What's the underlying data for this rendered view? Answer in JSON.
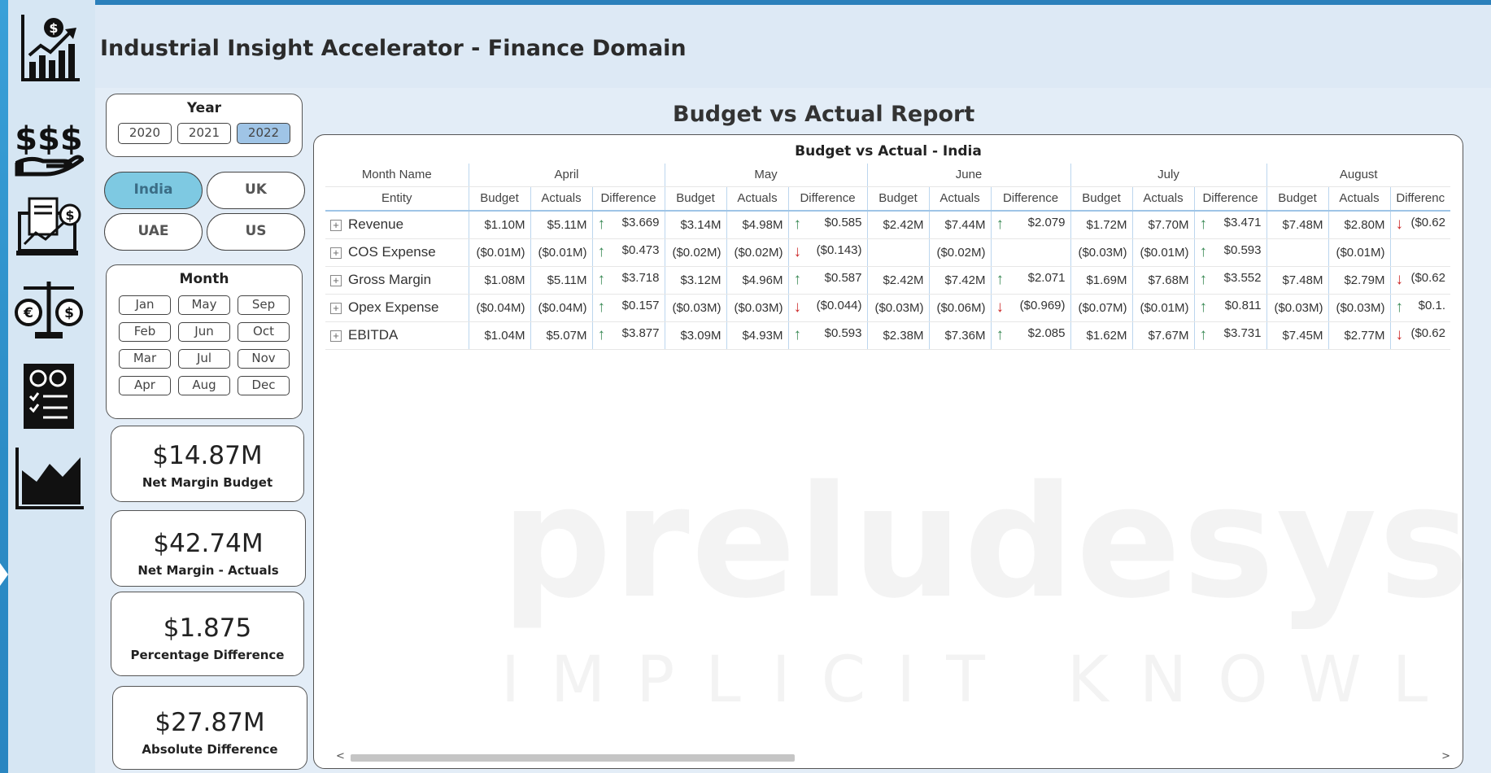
{
  "app": {
    "title": "Industrial Insight Accelerator - Finance Domain"
  },
  "rail": {
    "icons": [
      "growth-chart-icon",
      "money-hand-icon",
      "report-monitor-icon",
      "balance-scale-icon",
      "checklist-icon",
      "area-chart-icon"
    ]
  },
  "filters": {
    "year_title": "Year",
    "years": [
      "2020",
      "2021",
      "2022"
    ],
    "selected_year": "2022",
    "countries": [
      "India",
      "UK",
      "UAE",
      "US"
    ],
    "selected_country": "India",
    "month_title": "Month",
    "months": [
      "Jan",
      "May",
      "Sep",
      "Feb",
      "Jun",
      "Oct",
      "Mar",
      "Jul",
      "Nov",
      "Apr",
      "Aug",
      "Dec"
    ]
  },
  "kpis": [
    {
      "value": "$14.87M",
      "label": "Net Margin Budget"
    },
    {
      "value": "$42.74M",
      "label": "Net Margin - Actuals"
    },
    {
      "value": "$1.875",
      "label": "Percentage Difference"
    },
    {
      "value": "$27.87M",
      "label": "Absolute Difference"
    }
  ],
  "report": {
    "title": "Budget vs Actual Report",
    "table_title": "Budget vs Actual - India",
    "row_header_top": "Month Name",
    "row_header_bottom": "Entity",
    "months": [
      "April",
      "May",
      "June",
      "July",
      "August"
    ],
    "sub_headers": [
      "Budget",
      "Actuals",
      "Difference"
    ],
    "last_difference_label": "Differenc",
    "rows": [
      {
        "entity": "Revenue",
        "cells": [
          [
            "$1.10M",
            "$5.11M",
            "up",
            "$3.669"
          ],
          [
            "$3.14M",
            "$4.98M",
            "up",
            "$0.585"
          ],
          [
            "$2.42M",
            "$7.44M",
            "up",
            "$2.079"
          ],
          [
            "$1.72M",
            "$7.70M",
            "up",
            "$3.471"
          ],
          [
            "$7.48M",
            "$2.80M",
            "down",
            "($0.62"
          ]
        ]
      },
      {
        "entity": "COS Expense",
        "cells": [
          [
            "($0.01M)",
            "($0.01M)",
            "up",
            "$0.473"
          ],
          [
            "($0.02M)",
            "($0.02M)",
            "down",
            "($0.143)"
          ],
          [
            "",
            "($0.02M)",
            "",
            ""
          ],
          [
            "($0.03M)",
            "($0.01M)",
            "up",
            "$0.593"
          ],
          [
            "",
            "($0.01M)",
            "",
            ""
          ]
        ]
      },
      {
        "entity": "Gross Margin",
        "cells": [
          [
            "$1.08M",
            "$5.11M",
            "up",
            "$3.718"
          ],
          [
            "$3.12M",
            "$4.96M",
            "up",
            "$0.587"
          ],
          [
            "$2.42M",
            "$7.42M",
            "up",
            "$2.071"
          ],
          [
            "$1.69M",
            "$7.68M",
            "up",
            "$3.552"
          ],
          [
            "$7.48M",
            "$2.79M",
            "down",
            "($0.62"
          ]
        ]
      },
      {
        "entity": "Opex Expense",
        "cells": [
          [
            "($0.04M)",
            "($0.04M)",
            "up",
            "$0.157"
          ],
          [
            "($0.03M)",
            "($0.03M)",
            "down",
            "($0.044)"
          ],
          [
            "($0.03M)",
            "($0.06M)",
            "down",
            "($0.969)"
          ],
          [
            "($0.07M)",
            "($0.01M)",
            "up",
            "$0.811"
          ],
          [
            "($0.03M)",
            "($0.03M)",
            "up",
            "$0.1."
          ]
        ]
      },
      {
        "entity": "EBITDA",
        "cells": [
          [
            "$1.04M",
            "$5.07M",
            "up",
            "$3.877"
          ],
          [
            "$3.09M",
            "$4.93M",
            "up",
            "$0.593"
          ],
          [
            "$2.38M",
            "$7.36M",
            "up",
            "$2.085"
          ],
          [
            "$1.62M",
            "$7.67M",
            "up",
            "$3.731"
          ],
          [
            "$7.45M",
            "$2.77M",
            "down",
            "($0.62"
          ]
        ]
      }
    ]
  },
  "colors": {
    "accent": "#2b80bb",
    "selected_chip": "#9fc4e6",
    "selected_country": "#7ec9e2",
    "up": "#3a8a55",
    "down": "#cc2a2a"
  }
}
